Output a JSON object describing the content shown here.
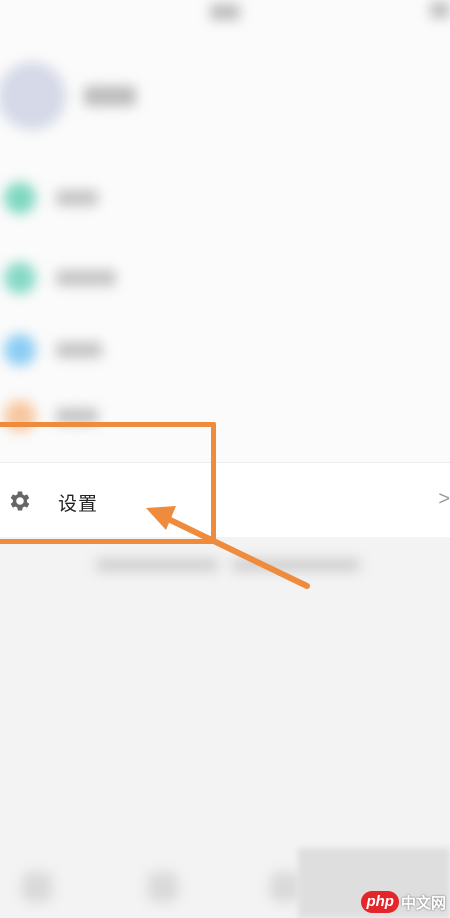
{
  "settings": {
    "label": "设置",
    "chevron": ">"
  },
  "watermark": {
    "badge": "php",
    "site": "中文网"
  },
  "colors": {
    "annotation": "#ef8b3c",
    "menu_dot_1": "#7fd8c0",
    "menu_dot_2": "#86d9c6",
    "menu_dot_3": "#8ccdf3",
    "menu_dot_4": "#f7c79f"
  },
  "icons": {
    "settings": "gear-icon",
    "row_arrow": "chevron-right-icon"
  }
}
